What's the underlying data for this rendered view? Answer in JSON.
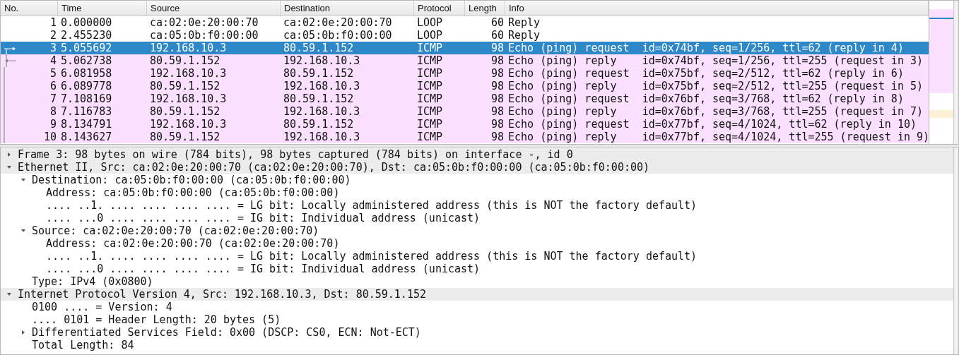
{
  "packet_list": {
    "columns": [
      "No.",
      "Time",
      "Source",
      "Destination",
      "Protocol",
      "Length",
      "Info"
    ],
    "rows": [
      {
        "no": "1",
        "time": "0.000000",
        "source": "ca:02:0e:20:00:70",
        "destination": "ca:02:0e:20:00:70",
        "protocol": "LOOP",
        "length": "60",
        "info": "Reply",
        "selected": false,
        "color": "#ffffff",
        "kind": "plain"
      },
      {
        "no": "2",
        "time": "2.455230",
        "source": "ca:05:0b:f0:00:00",
        "destination": "ca:05:0b:f0:00:00",
        "protocol": "LOOP",
        "length": "60",
        "info": "Reply",
        "selected": false,
        "color": "#ffffff",
        "kind": "plain"
      },
      {
        "no": "3",
        "time": "5.055692",
        "source": "192.168.10.3",
        "destination": "80.59.1.152",
        "protocol": "ICMP",
        "length": "98",
        "info": "Echo (ping) request  id=0x74bf, seq=1/256, ttl=62 (reply in 4)",
        "selected": true,
        "kind": "request"
      },
      {
        "no": "4",
        "time": "5.062738",
        "source": "80.59.1.152",
        "destination": "192.168.10.3",
        "protocol": "ICMP",
        "length": "98",
        "info": "Echo (ping) reply    id=0x74bf, seq=1/256, ttl=255 (request in 3)",
        "selected": false,
        "color": "#fce0ff",
        "kind": "reply"
      },
      {
        "no": "5",
        "time": "6.081958",
        "source": "192.168.10.3",
        "destination": "80.59.1.152",
        "protocol": "ICMP",
        "length": "98",
        "info": "Echo (ping) request  id=0x75bf, seq=2/512, ttl=62 (reply in 6)",
        "selected": false,
        "color": "#fce0ff",
        "kind": "line"
      },
      {
        "no": "6",
        "time": "6.089778",
        "source": "80.59.1.152",
        "destination": "192.168.10.3",
        "protocol": "ICMP",
        "length": "98",
        "info": "Echo (ping) reply    id=0x75bf, seq=2/512, ttl=255 (request in 5)",
        "selected": false,
        "color": "#fce0ff",
        "kind": "line"
      },
      {
        "no": "7",
        "time": "7.108169",
        "source": "192.168.10.3",
        "destination": "80.59.1.152",
        "protocol": "ICMP",
        "length": "98",
        "info": "Echo (ping) request  id=0x76bf, seq=3/768, ttl=62 (reply in 8)",
        "selected": false,
        "color": "#fce0ff",
        "kind": "line"
      },
      {
        "no": "8",
        "time": "7.116783",
        "source": "80.59.1.152",
        "destination": "192.168.10.3",
        "protocol": "ICMP",
        "length": "98",
        "info": "Echo (ping) reply    id=0x76bf, seq=3/768, ttl=255 (request in 7)",
        "selected": false,
        "color": "#fce0ff",
        "kind": "line"
      },
      {
        "no": "9",
        "time": "8.134791",
        "source": "192.168.10.3",
        "destination": "80.59.1.152",
        "protocol": "ICMP",
        "length": "98",
        "info": "Echo (ping) request  id=0x77bf, seq=4/1024, ttl=62 (reply in 10)",
        "selected": false,
        "color": "#fce0ff",
        "kind": "line"
      },
      {
        "no": "10",
        "time": "8.143627",
        "source": "80.59.1.152",
        "destination": "192.168.10.3",
        "protocol": "ICMP",
        "length": "98",
        "info": "Echo (ping) reply    id=0x77bf, seq=4/1024, ttl=255 (request in 9)",
        "selected": false,
        "color": "#fce0ff",
        "kind": "line"
      }
    ]
  },
  "details": [
    {
      "text": "Frame 3: 98 bytes on wire (784 bits), 98 bytes captured (784 bits) on interface -, id 0",
      "expanded": false
    },
    {
      "text": "Ethernet II, Src: ca:02:0e:20:00:70 (ca:02:0e:20:00:70), Dst: ca:05:0b:f0:00:00 (ca:05:0b:f0:00:00)",
      "expanded": true,
      "children": [
        {
          "text": "Destination: ca:05:0b:f0:00:00 (ca:05:0b:f0:00:00)",
          "expanded": true,
          "children": [
            {
              "text": "Address: ca:05:0b:f0:00:00 (ca:05:0b:f0:00:00)"
            },
            {
              "text": ".... ..1. .... .... .... .... = LG bit: Locally administered address (this is NOT the factory default)"
            },
            {
              "text": ".... ...0 .... .... .... .... = IG bit: Individual address (unicast)"
            }
          ]
        },
        {
          "text": "Source: ca:02:0e:20:00:70 (ca:02:0e:20:00:70)",
          "expanded": true,
          "children": [
            {
              "text": "Address: ca:02:0e:20:00:70 (ca:02:0e:20:00:70)"
            },
            {
              "text": ".... ..1. .... .... .... .... = LG bit: Locally administered address (this is NOT the factory default)"
            },
            {
              "text": ".... ...0 .... .... .... .... = IG bit: Individual address (unicast)"
            }
          ]
        },
        {
          "text": "Type: IPv4 (0x0800)"
        }
      ]
    },
    {
      "text": "Internet Protocol Version 4, Src: 192.168.10.3, Dst: 80.59.1.152",
      "expanded": true,
      "children": [
        {
          "text": "0100 .... = Version: 4"
        },
        {
          "text": ".... 0101 = Header Length: 20 bytes (5)"
        },
        {
          "text": "Differentiated Services Field: 0x00 (DSCP: CS0, ECN: Not-ECT)",
          "expanded": false
        },
        {
          "text": "Total Length: 84"
        }
      ]
    }
  ]
}
